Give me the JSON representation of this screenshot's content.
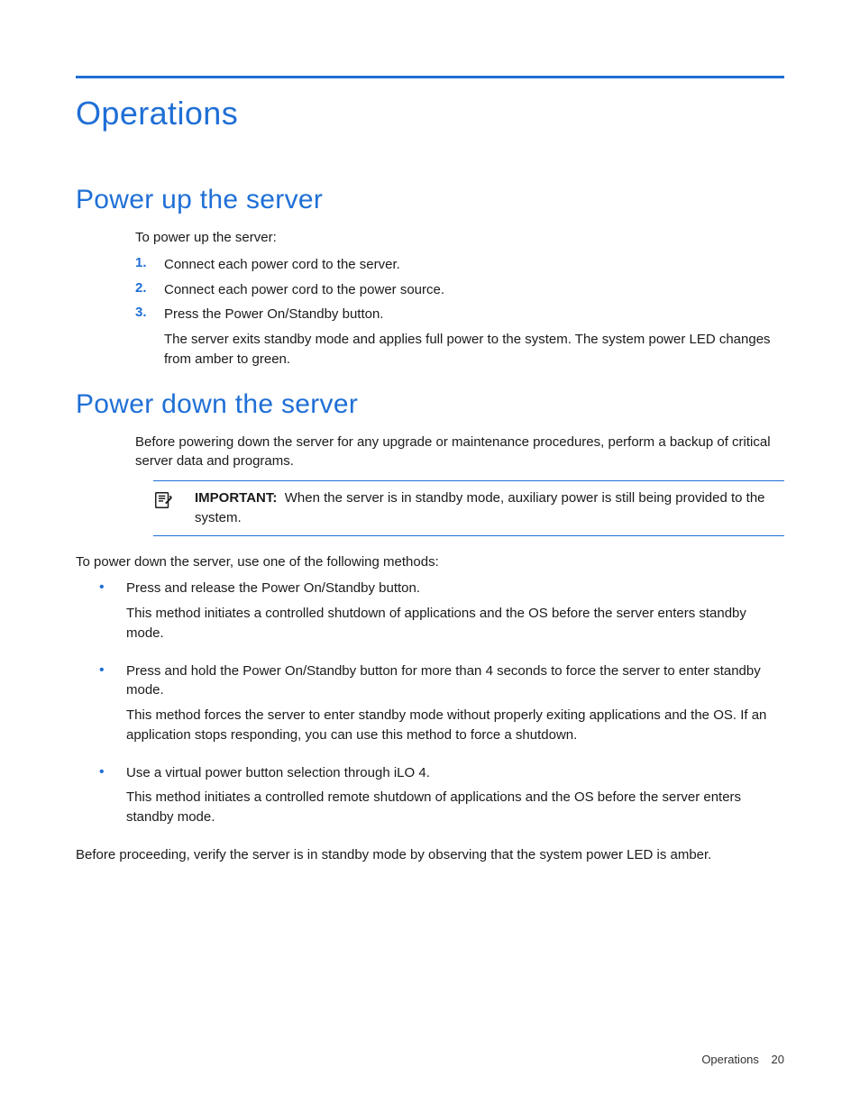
{
  "chapter_title": "Operations",
  "section1": {
    "title": "Power up the server",
    "intro": "To power up the server:",
    "steps": [
      {
        "num": "1.",
        "text": "Connect each power cord to the server."
      },
      {
        "num": "2.",
        "text": "Connect each power cord to the power source."
      },
      {
        "num": "3.",
        "text": "Press the Power On/Standby button.",
        "sub": "The server exits standby mode and applies full power to the system. The system power LED changes from amber to green."
      }
    ]
  },
  "section2": {
    "title": "Power down the server",
    "intro": "Before powering down the server for any upgrade or maintenance procedures, perform a backup of critical server data and programs.",
    "note_label": "IMPORTANT:",
    "note_body": "When the server is in standby mode, auxiliary power is still being provided to the system.",
    "methods_intro": "To power down the server, use one of the following methods:",
    "bullets": [
      {
        "lead": "Press and release the Power On/Standby button.",
        "detail": "This method initiates a controlled shutdown of applications and the OS before the server enters standby mode."
      },
      {
        "lead": "Press and hold the Power On/Standby button for more than 4 seconds to force the server to enter standby mode.",
        "detail": "This method forces the server to enter standby mode without properly exiting applications and the OS. If an application stops responding, you can use this method to force a shutdown."
      },
      {
        "lead": "Use a virtual power button selection through iLO 4.",
        "detail": "This method initiates a controlled remote shutdown of applications and the OS before the server enters standby mode."
      }
    ],
    "closing": "Before proceeding, verify the server is in standby mode by observing that the system power LED is amber."
  },
  "footer": {
    "section": "Operations",
    "page": "20"
  }
}
